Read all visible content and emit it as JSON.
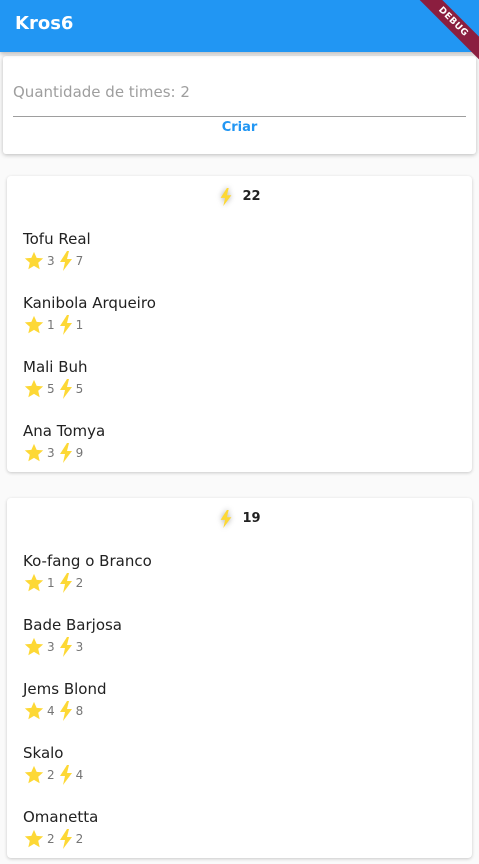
{
  "app": {
    "title": "Kros6",
    "debug_label": "DEBUG"
  },
  "form": {
    "input_value": "Quantidade de times: 2",
    "button_label": "Criar"
  },
  "colors": {
    "appbar": "#2196f3",
    "accent": "#2196f3",
    "star": "#fdd835",
    "bolt": "#fdd835"
  },
  "icons": {
    "skill": "star-icon",
    "power": "bolt-icon"
  },
  "teams": [
    {
      "total": "22",
      "players": [
        {
          "name": "Tofu Real",
          "stars": "3",
          "power": "7"
        },
        {
          "name": "Kanibola Arqueiro",
          "stars": "1",
          "power": "1"
        },
        {
          "name": "Mali Buh",
          "stars": "5",
          "power": "5"
        },
        {
          "name": "Ana Tomya",
          "stars": "3",
          "power": "9"
        }
      ]
    },
    {
      "total": "19",
      "players": [
        {
          "name": "Ko-fang o Branco",
          "stars": "1",
          "power": "2"
        },
        {
          "name": "Bade Barjosa",
          "stars": "3",
          "power": "3"
        },
        {
          "name": "Jems Blond",
          "stars": "4",
          "power": "8"
        },
        {
          "name": "Skalo",
          "stars": "2",
          "power": "4"
        },
        {
          "name": "Omanetta",
          "stars": "2",
          "power": "2"
        }
      ]
    }
  ]
}
